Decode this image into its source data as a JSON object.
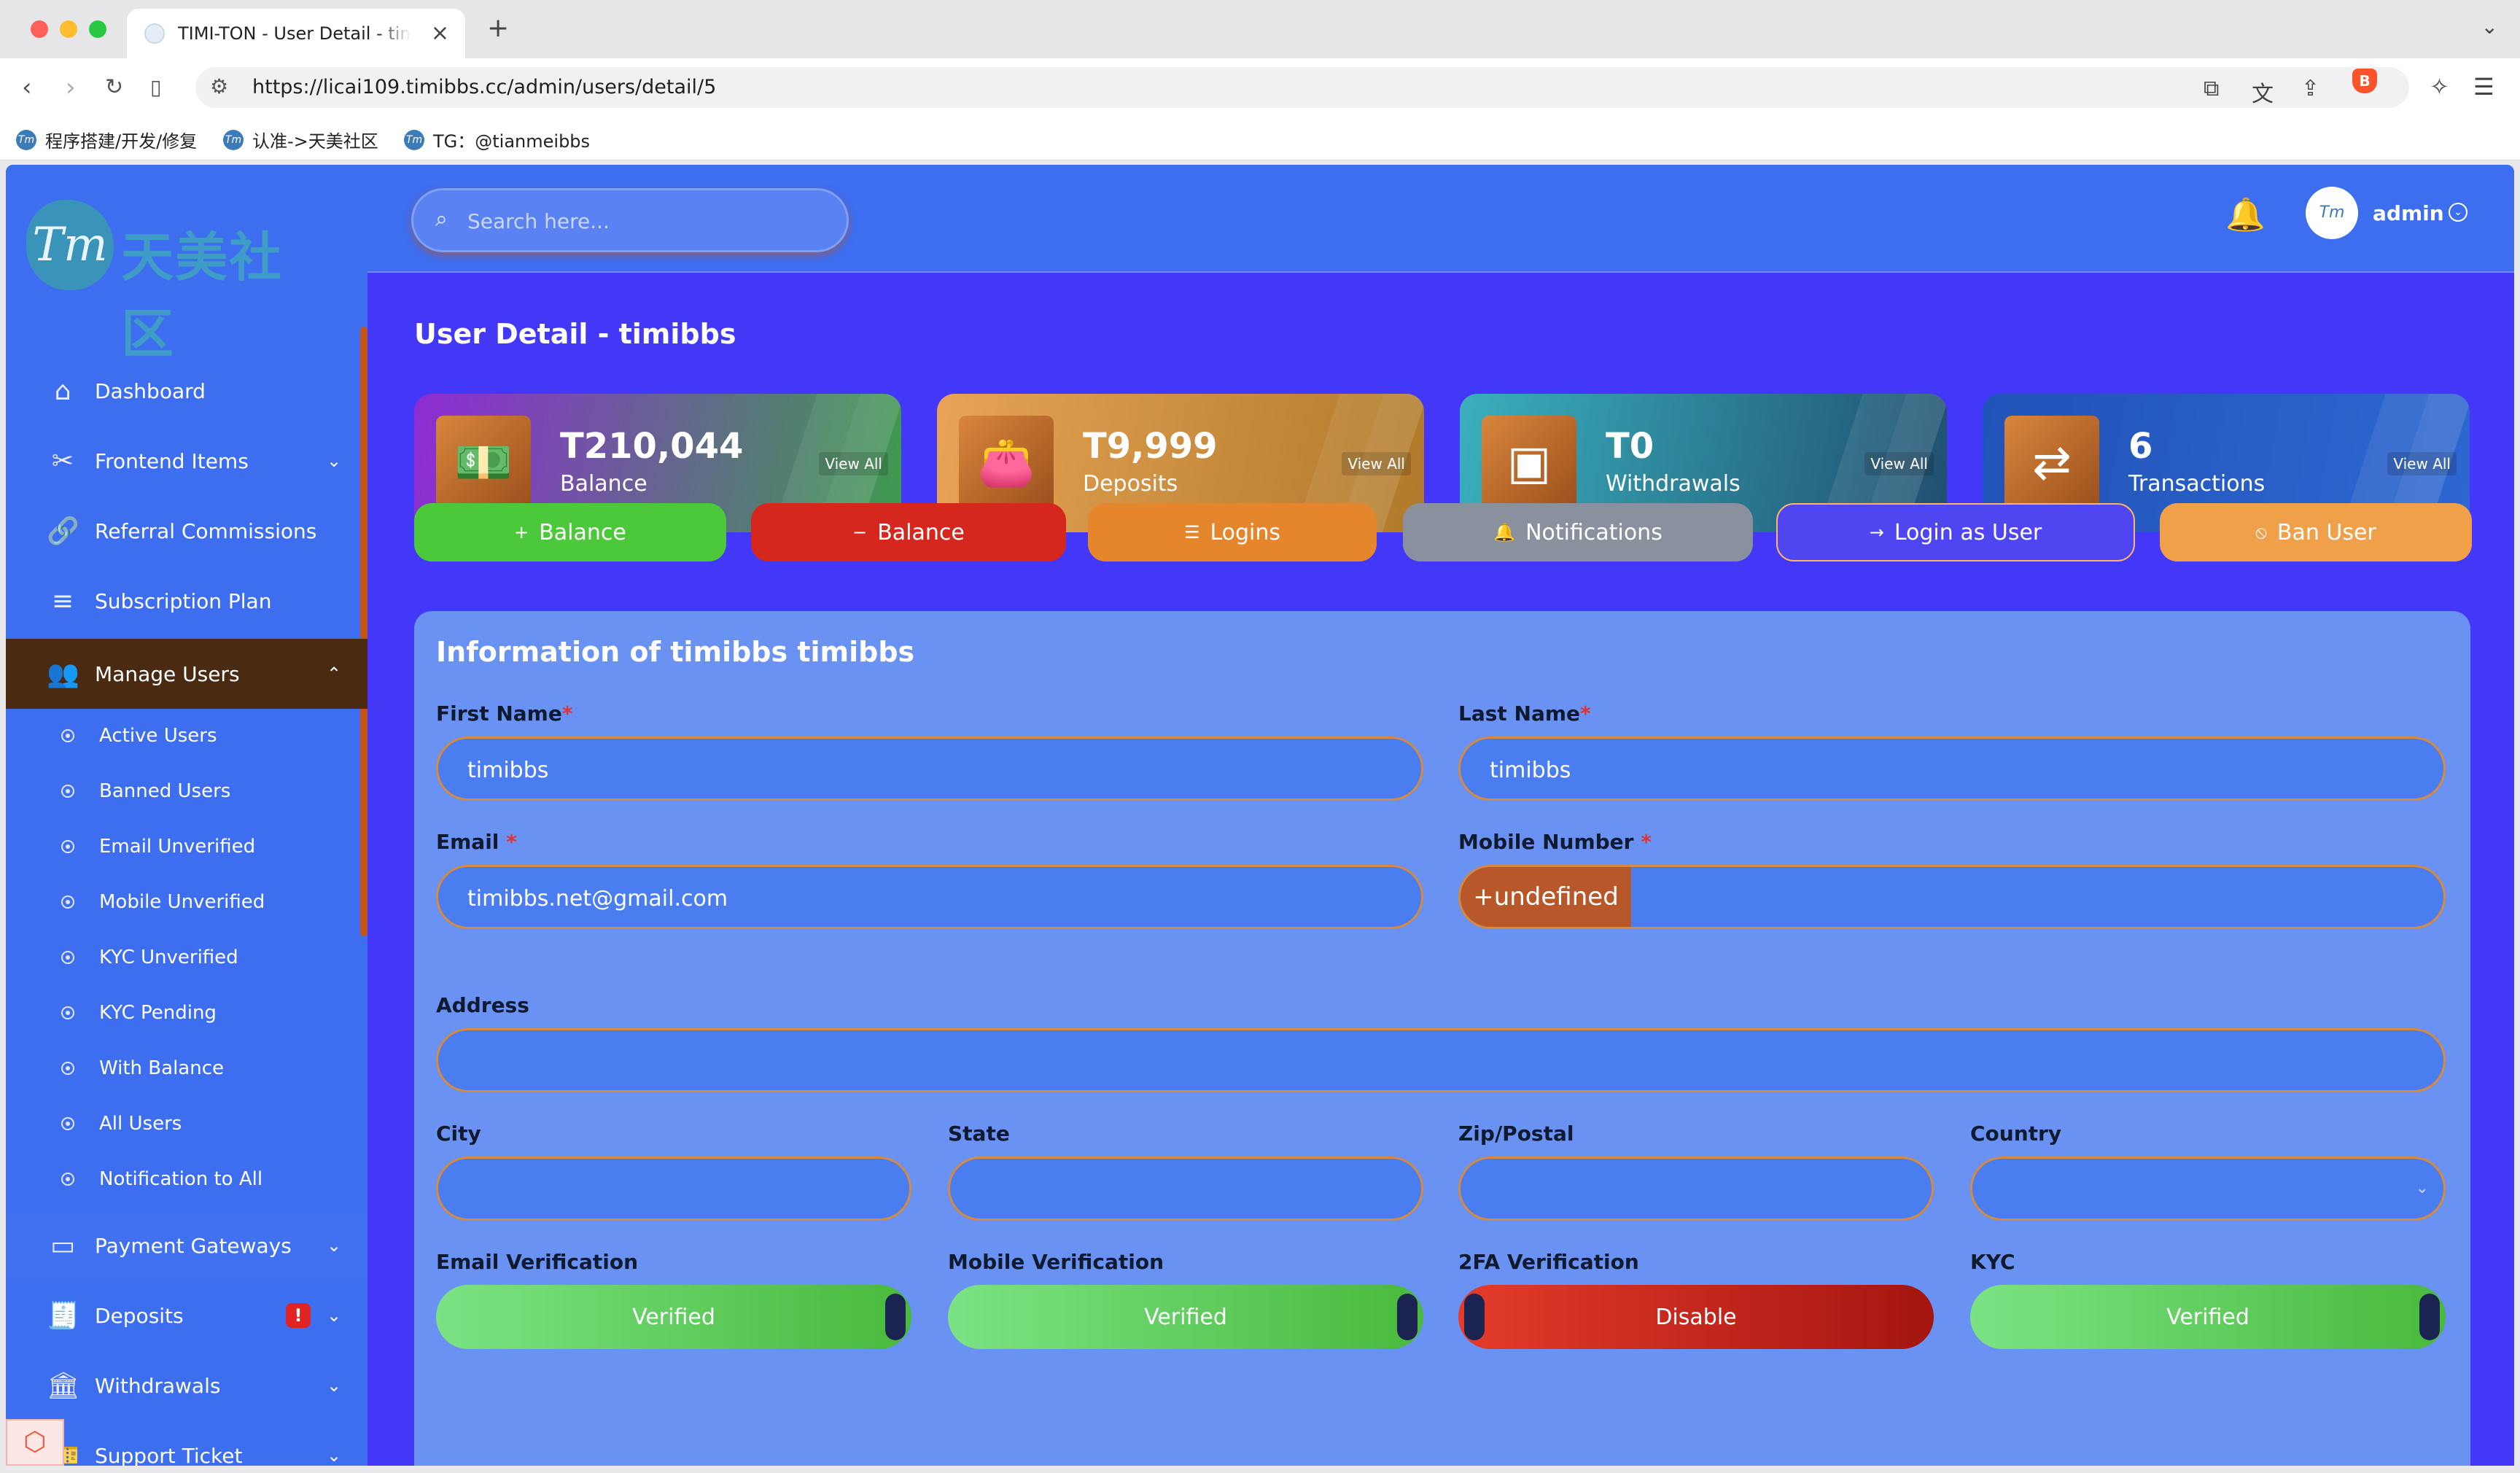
{
  "browser": {
    "tab_title": "TIMI-TON - User Detail - timibbs",
    "url": "https://licai109.timibbs.cc/admin/users/detail/5",
    "bookmarks": [
      "程序搭建/开发/修复",
      "认准->天美社区",
      "TG：@tianmeibbs"
    ]
  },
  "sidebar": {
    "logo_text": "天美社区",
    "logo_mark": "Tm",
    "items": [
      {
        "label": "Dashboard",
        "icon": "home-icon"
      },
      {
        "label": "Frontend Items",
        "icon": "tools-icon"
      },
      {
        "label": "Referral Commissions",
        "icon": "link-icon"
      },
      {
        "label": "Subscription Plan",
        "icon": "list-icon"
      },
      {
        "label": "Manage Users",
        "icon": "users-icon"
      }
    ],
    "sub_items": [
      "Active Users",
      "Banned Users",
      "Email Unverified",
      "Mobile Unverified",
      "KYC Unverified",
      "KYC Pending",
      "With Balance",
      "All Users",
      "Notification to All"
    ],
    "items_bottom": [
      {
        "label": "Payment Gateways",
        "icon": "card-icon"
      },
      {
        "label": "Deposits",
        "icon": "receipt-icon",
        "badge": "!"
      },
      {
        "label": "Withdrawals",
        "icon": "bank-icon"
      },
      {
        "label": "Support Ticket",
        "icon": "ticket-icon"
      }
    ]
  },
  "header": {
    "search_placeholder": "Search here...",
    "admin_name": "admin"
  },
  "page": {
    "title": "User Detail - timibbs"
  },
  "stats": [
    {
      "value": "T210,044",
      "label": "Balance",
      "link": "View All",
      "color_from": "#8f2bd6",
      "color_to": "#3e9b4e"
    },
    {
      "value": "T9,999",
      "label": "Deposits",
      "link": "View All",
      "color_from": "#e8a356",
      "color_to": "#b07a2a"
    },
    {
      "value": "T0",
      "label": "Withdrawals",
      "link": "View All",
      "color_from": "#3ab0bc",
      "color_to": "#1f4f70"
    },
    {
      "value": "6",
      "label": "Transactions",
      "link": "View All",
      "color_from": "#2153b8",
      "color_to": "#2e67d1"
    }
  ],
  "actions": [
    {
      "label": "Balance",
      "icon": "+",
      "color": "#4cc93a"
    },
    {
      "label": "Balance",
      "icon": "−",
      "color": "#d5271d"
    },
    {
      "label": "Logins",
      "icon": "☰",
      "color": "#e5862d"
    },
    {
      "label": "Notifications",
      "icon": "🔔",
      "color": "#8a919e"
    },
    {
      "label": "Login as User",
      "icon": "→",
      "color": "#4f46f2"
    },
    {
      "label": "Ban User",
      "icon": "⦸",
      "color": "#f1a04a"
    }
  ],
  "info": {
    "title": "Information of timibbs timibbs",
    "first_name_label": "First Name",
    "first_name": "timibbs",
    "last_name_label": "Last Name",
    "last_name": "timibbs",
    "email_label": "Email",
    "email": "timibbs.net@gmail.com",
    "mobile_label": "Mobile Number",
    "mobile_prefix": "+undefined",
    "mobile": "",
    "address_label": "Address",
    "address": "",
    "city_label": "City",
    "city": "",
    "state_label": "State",
    "state": "",
    "zip_label": "Zip/Postal",
    "zip": "",
    "country_label": "Country",
    "country": "",
    "required_mark": "*",
    "toggles": [
      {
        "label": "Email Verification",
        "value": "Verified",
        "on": true
      },
      {
        "label": "Mobile Verification",
        "value": "Verified",
        "on": true
      },
      {
        "label": "2FA Verification",
        "value": "Disable",
        "on": false
      },
      {
        "label": "KYC",
        "value": "Verified",
        "on": true
      }
    ]
  }
}
